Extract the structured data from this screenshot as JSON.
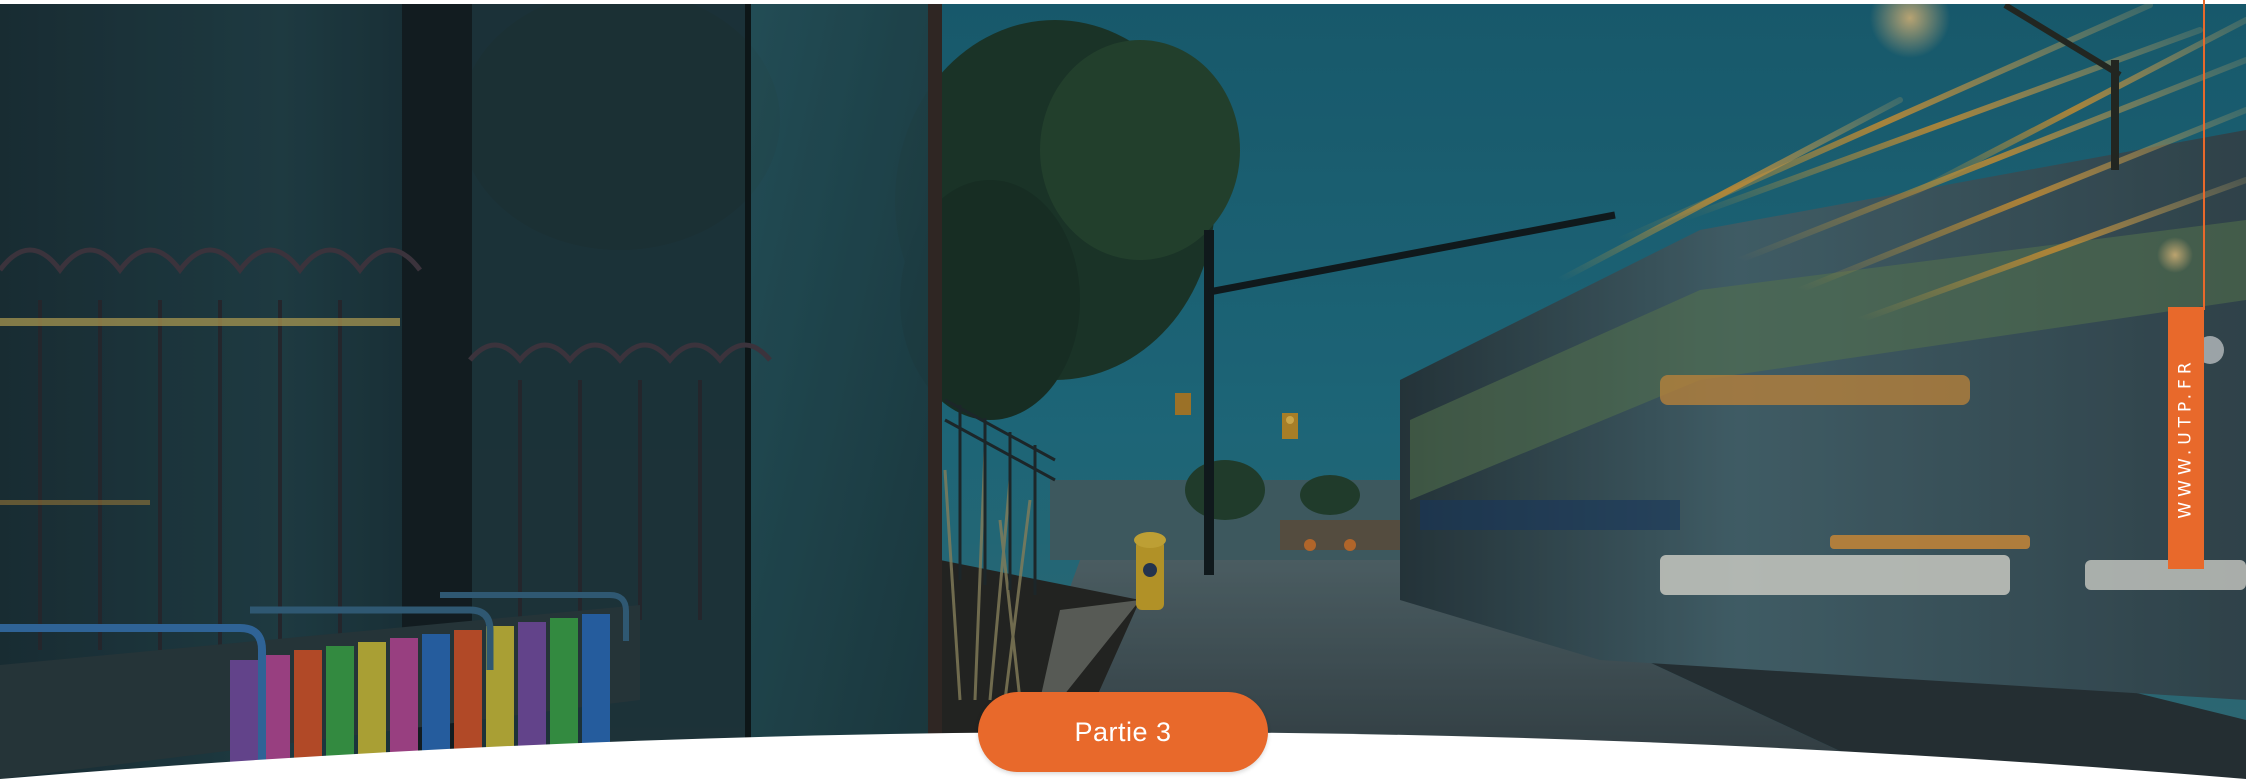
{
  "slide": {
    "section_label": "Partie 3",
    "website": "WWW.UTP.FR"
  },
  "image": {
    "description_icon": "night-street-tram-photo"
  },
  "colors": {
    "accent": "#e8692b",
    "sky": "#1f6f84",
    "background": "#ffffff"
  }
}
